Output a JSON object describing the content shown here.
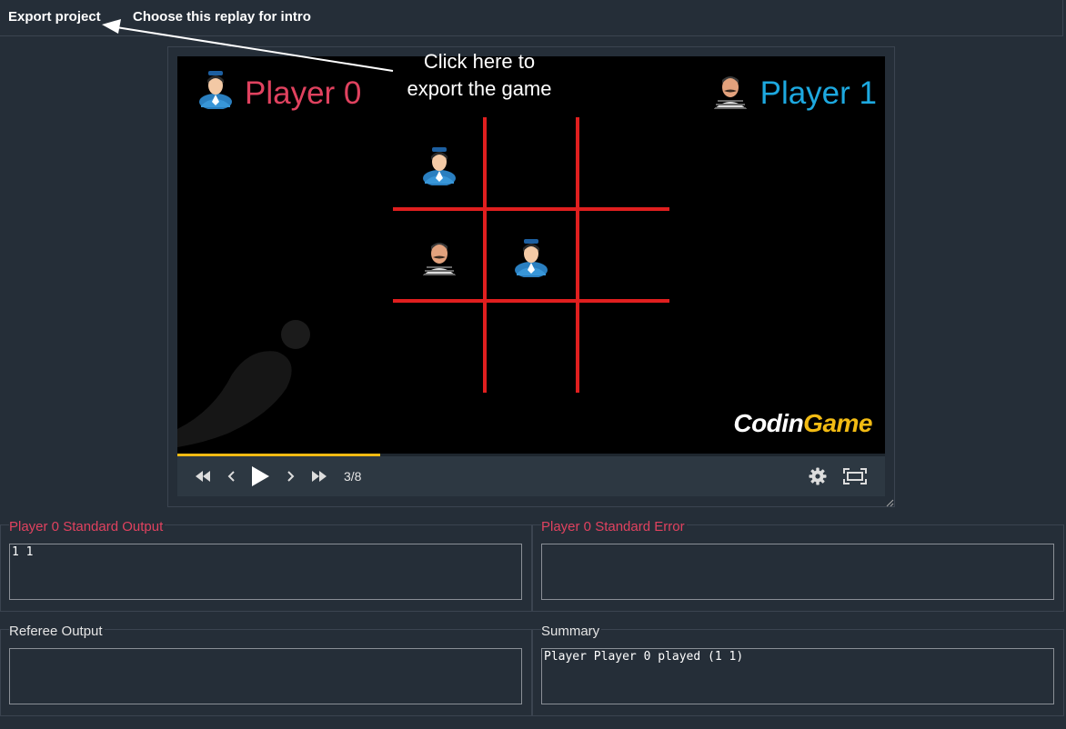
{
  "topbar": {
    "export_label": "Export project",
    "choose_label": "Choose this replay for intro"
  },
  "callout": {
    "line1": "Click here to",
    "line2": "export the game"
  },
  "viewer": {
    "player0_name": "Player 0",
    "player1_name": "Player 1",
    "player0_color": "#e0425f",
    "player1_color": "#1da9e0",
    "board": [
      [
        "player0",
        "",
        ""
      ],
      [
        "player1",
        "player0",
        ""
      ],
      [
        "",
        "",
        ""
      ]
    ],
    "logo_part1": "Codin",
    "logo_part2": "Game"
  },
  "playback": {
    "current_frame": 3,
    "total_frames": 8,
    "frame_label": "3/8",
    "progress": 0.286,
    "icons": [
      "fast-rewind-icon",
      "step-back-icon",
      "play-icon",
      "step-forward-icon",
      "fast-forward-icon",
      "gear-icon",
      "fullscreen-icon"
    ]
  },
  "panels": {
    "stdout_title": "Player 0 Standard Output",
    "stdout_value": "1 1",
    "stderr_title": "Player 0 Standard Error",
    "stderr_value": "",
    "referee_title": "Referee Output",
    "referee_value": "",
    "summary_title": "Summary",
    "summary_value": "Player Player 0 played (1 1)"
  }
}
